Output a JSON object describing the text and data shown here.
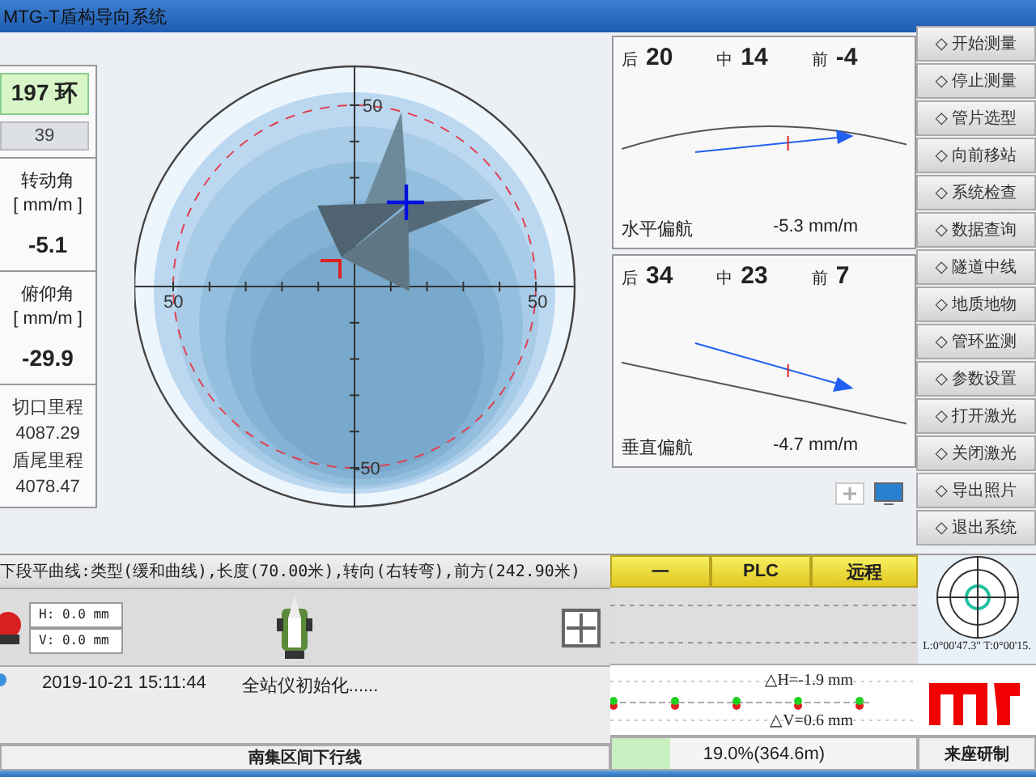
{
  "window": {
    "title": "MTG-T盾构导向系统"
  },
  "ring_panel": {
    "ring": "197 环",
    "segment": "39",
    "angles": [
      {
        "label": "转动角",
        "unit": "[ mm/m ]",
        "value": "-5.1"
      },
      {
        "label": "俯仰角",
        "unit": "[ mm/m ]",
        "value": "-29.9"
      }
    ],
    "mileage": [
      {
        "label": "切口里程",
        "value": "4087.29"
      },
      {
        "label": "盾尾里程",
        "value": "4078.47"
      }
    ]
  },
  "target_view": {
    "top_label": "50",
    "left_label": "50",
    "right_label": "50",
    "bottom_label": "-50"
  },
  "deviation_charts": [
    {
      "kind": "horizontal",
      "readings": [
        {
          "label": "后",
          "value": "20"
        },
        {
          "label": "中",
          "value": "14"
        },
        {
          "label": "前",
          "value": "-4"
        }
      ],
      "title": "水平偏航",
      "rate": "-5.3 mm/m"
    },
    {
      "kind": "vertical",
      "readings": [
        {
          "label": "后",
          "value": "34"
        },
        {
          "label": "中",
          "value": "23"
        },
        {
          "label": "前",
          "value": "7"
        }
      ],
      "title": "垂直偏航",
      "rate": "-4.7 mm/m"
    }
  ],
  "menu_buttons": [
    "◇ 开始测量",
    "◇ 停止测量",
    "◇ 管片选型",
    "◇ 向前移站",
    "◇ 系统检查",
    "◇ 数据查询",
    "◇ 隧道中线",
    "◇ 地质地物",
    "◇ 管环监测",
    "◇ 参数设置",
    "◇ 打开激光",
    "◇ 关闭激光",
    "◇ 导出照片",
    "◇ 退出系统"
  ],
  "info_bar": "下段平曲线:类型(缓和曲线),长度(70.00米),转向(右转弯),前方(242.90米)",
  "station": {
    "h_field": "H: 0.0 mm",
    "v_field": "V: 0.0 mm"
  },
  "log": [
    {
      "time": "2019-10-21 15:11:44",
      "message": "全站仪初始化......"
    }
  ],
  "plc_header": [
    "一",
    "PLC",
    "远程"
  ],
  "trend": {
    "dh": "△H=-1.9 mm",
    "dv": "△V=0.6 mm"
  },
  "laser_target": {
    "reading": "L:0°00'47.3\" T:0°00'15."
  },
  "status_bar": {
    "line": "南集区间下行线",
    "progress": {
      "level": 0.19,
      "text": "19.0%(364.6m)"
    },
    "credit": "来座研制"
  }
}
